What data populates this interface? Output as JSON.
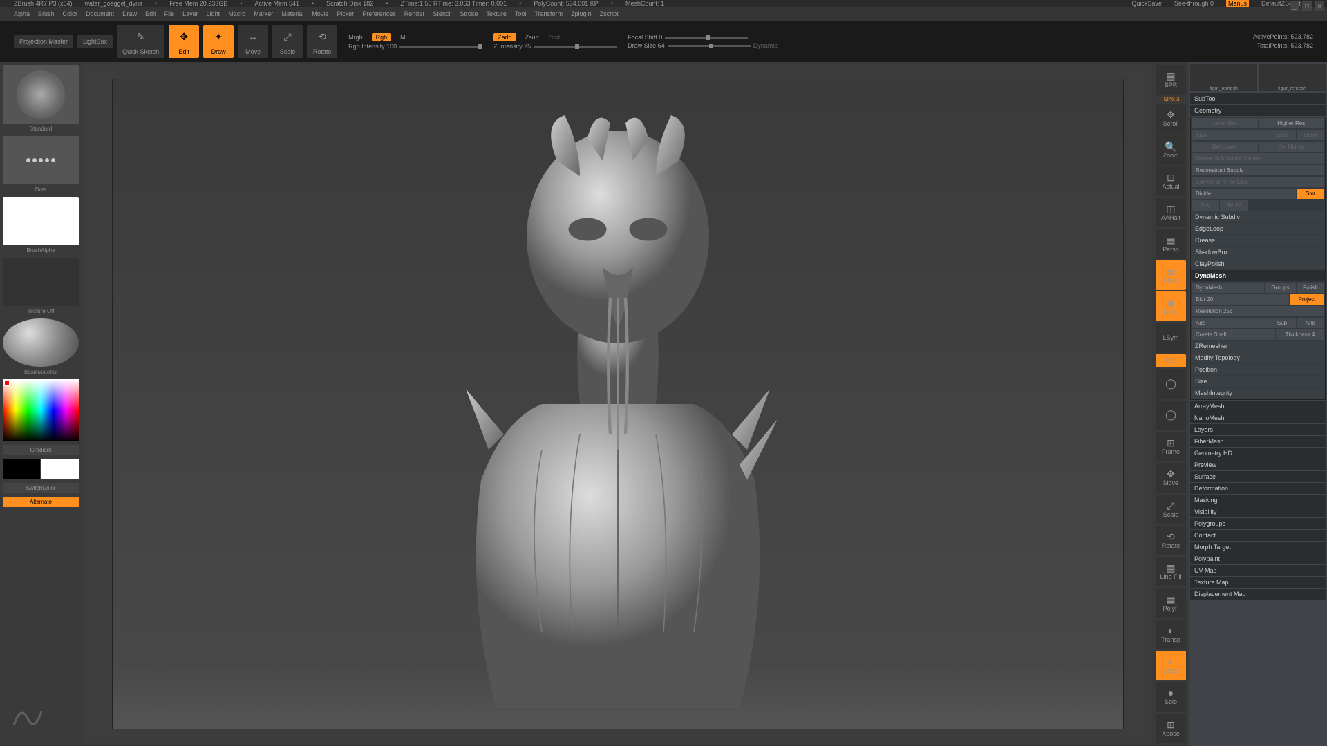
{
  "title": {
    "app": "ZBrush 4R7 P3 (x64)",
    "file": "water_goeggel_dyna",
    "freemem": "Free Mem 20.233GB",
    "activemem": "Active Mem 541",
    "scratch": "Scratch Disk 182",
    "ztime": "ZTime:1.56 RTime: 3.063 Timer: 0.001",
    "polycount": "PolyCount: 534.001 KP",
    "meshcount": "MeshCount: 1",
    "quicksave": "QuickSave",
    "seethrough": "See-through   0",
    "menus": "Menus",
    "defaultzscript": "DefaultZScript"
  },
  "menu": [
    "Alpha",
    "Brush",
    "Color",
    "Document",
    "Draw",
    "Edit",
    "File",
    "Layer",
    "Light",
    "Macro",
    "Marker",
    "Material",
    "Movie",
    "Picker",
    "Preferences",
    "Render",
    "Stencil",
    "Stroke",
    "Texture",
    "Tool",
    "Transform",
    "Zplugin",
    "Zscript"
  ],
  "toolbar": {
    "projection": "Projection\nMaster",
    "lightbox": "LightBox",
    "quicksketch": "Quick\nSketch",
    "edit": "Edit",
    "draw": "Draw",
    "move": "Move",
    "scale": "Scale",
    "rotate": "Rotate",
    "mrgb": "Mrgb",
    "rgb": "Rgb",
    "m": "M",
    "rgbint": "Rgb Intensity 100",
    "zadd": "Zadd",
    "zsub": "Zsub",
    "zcut": "Zcut",
    "zint": "Z Intensity 25",
    "focal": "Focal Shift 0",
    "drawsize": "Draw Size 64",
    "dynamic": "Dynamic",
    "activepoints": "ActivePoints: 523,782",
    "totalpoints": "TotalPoints: 523,782"
  },
  "left": {
    "standard": "Standard",
    "dots": "Dots",
    "brushalpha": "BrushAlpha",
    "textureoff": "Texture Off",
    "basicmat": "BasicMaterial",
    "gradient": "Gradient",
    "switchcolor": "SwitchColor",
    "alternate": "Alternate"
  },
  "rtools": [
    "BPR",
    "Scroll",
    "Zoom",
    "Actual",
    "AAHalf",
    "Persp",
    "Floor",
    "Local",
    "LSym",
    "XYZ",
    "",
    "",
    "Frame",
    "Move",
    "Scale",
    "Rotate",
    "Line Fill",
    "PolyF",
    "Transp",
    "Ghost",
    "Solo",
    "Xpose"
  ],
  "rtools_label": {
    "spix": "SPix 3"
  },
  "rpanel": {
    "subtool": "SubTool",
    "geometry": "Geometry",
    "lowerres": "Lower Res",
    "higherres": "Higher Res",
    "sdiv": "SDiv",
    "loop": "Loop",
    "ratio": "Ratio",
    "dellower": "Del Lower",
    "delhigher": "Del Higher",
    "freeze": "Freeze SubDivision Levels",
    "reconstruct": "Reconstruct Subdiv",
    "convert": "Convert BPR To Geo",
    "divide": "Divide",
    "smt": "Smt",
    "suv": "Suv",
    "rstr": "ReUV",
    "dynsubdiv": "Dynamic Subdiv",
    "edgeloop": "EdgeLoop",
    "crease": "Crease",
    "shadowbox": "ShadowBox",
    "claypolish": "ClayPolish",
    "dynamesh": "DynaMesh",
    "dynameshbtn": "DynaMesh",
    "groups": "Groups",
    "polish": "Polish",
    "blur": "Blur 20",
    "project": "Project",
    "resolution": "Resolution 256",
    "add": "Add",
    "sub": "Sub",
    "and": "And",
    "createshell": "Create Shell",
    "thickness": "Thickness 4",
    "zremesher": "ZRemesher",
    "modtopo": "Modify Topology",
    "position": "Position",
    "size": "Size",
    "meshint": "MeshIntegrity",
    "arraymesh": "ArrayMesh",
    "nanomesh": "NanoMesh",
    "layers": "Layers",
    "fibermesh": "FiberMesh",
    "geomhd": "Geometry HD",
    "preview": "Preview",
    "surface": "Surface",
    "deformation": "Deformation",
    "masking": "Masking",
    "visibility": "Visibility",
    "polygroups": "Polygroups",
    "contact": "Contact",
    "morph": "Morph Target",
    "polypaint": "Polypaint",
    "uvmap": "UV Map",
    "texmap": "Texture Map",
    "dispmap": "Displacement Map"
  },
  "thumbs": {
    "figur": "figur_remesh"
  }
}
